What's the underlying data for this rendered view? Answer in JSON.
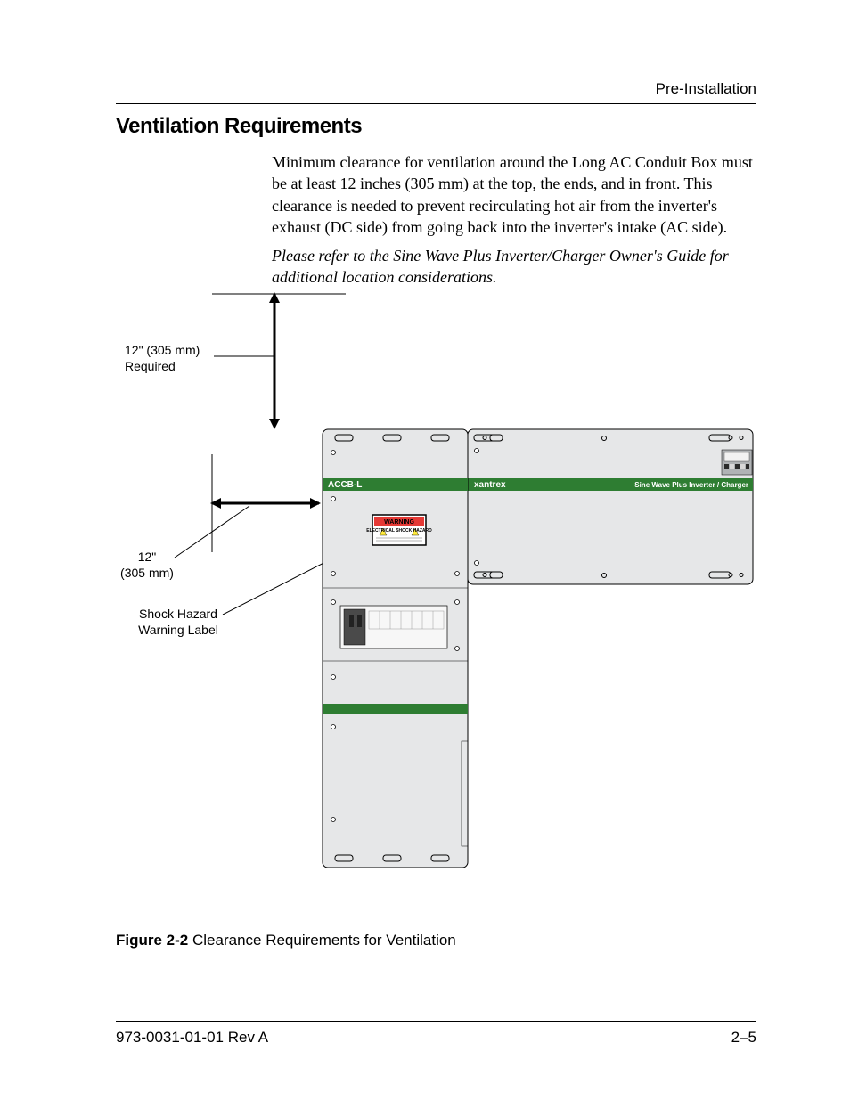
{
  "header": {
    "section": "Pre-Installation"
  },
  "title": "Ventilation Requirements",
  "body": {
    "p1": "Minimum clearance for ventilation around the Long AC Conduit Box must be at least 12 inches (305 mm) at the top, the ends, and in front. This clearance is needed to prevent recirculating hot air from the inverter's exhaust (DC side) from going back into the inverter's intake (AC side).",
    "p2": "Please refer to the Sine Wave Plus Inverter/Charger Owner's Guide for additional location considerations."
  },
  "figure": {
    "callout_top_1": "12\" (305 mm)",
    "callout_top_2": "Required",
    "callout_left_1": "12\"",
    "callout_left_2": "(305 mm)",
    "callout_hazard_1": "Shock Hazard",
    "callout_hazard_2": "Warning Label",
    "device_accb": "ACCB-L",
    "device_brand": "xantrex",
    "device_model": "Sine Wave Plus Inverter / Charger",
    "warning_word": "WARNING",
    "warning_sub": "ELECTRICAL SHOCK HAZARD"
  },
  "caption": {
    "number": "Figure 2-2",
    "text": "Clearance Requirements for Ventilation"
  },
  "footer": {
    "docnum": "973-0031-01-01 Rev A",
    "page": "2–5"
  }
}
